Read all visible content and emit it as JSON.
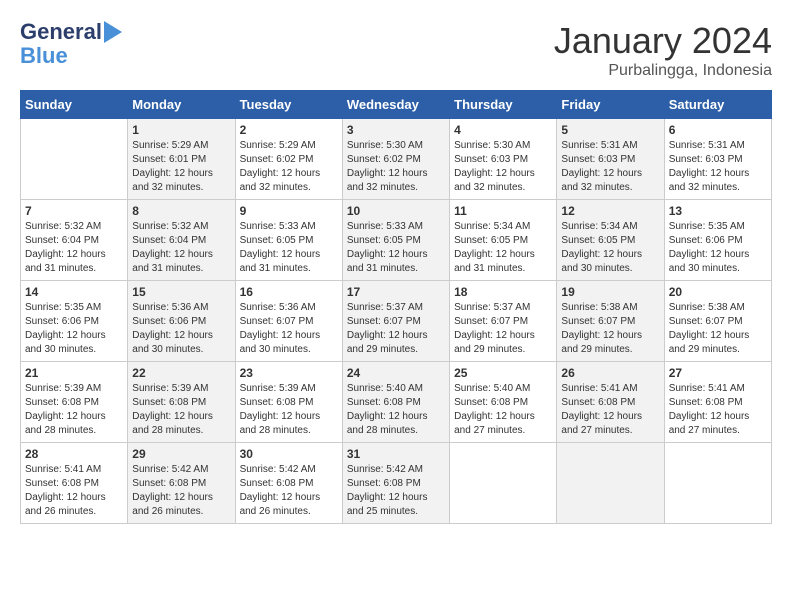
{
  "header": {
    "logo_line1": "General",
    "logo_line2": "Blue",
    "month": "January 2024",
    "location": "Purbalingga, Indonesia"
  },
  "weekdays": [
    "Sunday",
    "Monday",
    "Tuesday",
    "Wednesday",
    "Thursday",
    "Friday",
    "Saturday"
  ],
  "weeks": [
    [
      {
        "day": "",
        "info": ""
      },
      {
        "day": "1",
        "info": "Sunrise: 5:29 AM\nSunset: 6:01 PM\nDaylight: 12 hours\nand 32 minutes."
      },
      {
        "day": "2",
        "info": "Sunrise: 5:29 AM\nSunset: 6:02 PM\nDaylight: 12 hours\nand 32 minutes."
      },
      {
        "day": "3",
        "info": "Sunrise: 5:30 AM\nSunset: 6:02 PM\nDaylight: 12 hours\nand 32 minutes."
      },
      {
        "day": "4",
        "info": "Sunrise: 5:30 AM\nSunset: 6:03 PM\nDaylight: 12 hours\nand 32 minutes."
      },
      {
        "day": "5",
        "info": "Sunrise: 5:31 AM\nSunset: 6:03 PM\nDaylight: 12 hours\nand 32 minutes."
      },
      {
        "day": "6",
        "info": "Sunrise: 5:31 AM\nSunset: 6:03 PM\nDaylight: 12 hours\nand 32 minutes."
      }
    ],
    [
      {
        "day": "7",
        "info": "Sunrise: 5:32 AM\nSunset: 6:04 PM\nDaylight: 12 hours\nand 31 minutes."
      },
      {
        "day": "8",
        "info": "Sunrise: 5:32 AM\nSunset: 6:04 PM\nDaylight: 12 hours\nand 31 minutes."
      },
      {
        "day": "9",
        "info": "Sunrise: 5:33 AM\nSunset: 6:05 PM\nDaylight: 12 hours\nand 31 minutes."
      },
      {
        "day": "10",
        "info": "Sunrise: 5:33 AM\nSunset: 6:05 PM\nDaylight: 12 hours\nand 31 minutes."
      },
      {
        "day": "11",
        "info": "Sunrise: 5:34 AM\nSunset: 6:05 PM\nDaylight: 12 hours\nand 31 minutes."
      },
      {
        "day": "12",
        "info": "Sunrise: 5:34 AM\nSunset: 6:05 PM\nDaylight: 12 hours\nand 30 minutes."
      },
      {
        "day": "13",
        "info": "Sunrise: 5:35 AM\nSunset: 6:06 PM\nDaylight: 12 hours\nand 30 minutes."
      }
    ],
    [
      {
        "day": "14",
        "info": "Sunrise: 5:35 AM\nSunset: 6:06 PM\nDaylight: 12 hours\nand 30 minutes."
      },
      {
        "day": "15",
        "info": "Sunrise: 5:36 AM\nSunset: 6:06 PM\nDaylight: 12 hours\nand 30 minutes."
      },
      {
        "day": "16",
        "info": "Sunrise: 5:36 AM\nSunset: 6:07 PM\nDaylight: 12 hours\nand 30 minutes."
      },
      {
        "day": "17",
        "info": "Sunrise: 5:37 AM\nSunset: 6:07 PM\nDaylight: 12 hours\nand 29 minutes."
      },
      {
        "day": "18",
        "info": "Sunrise: 5:37 AM\nSunset: 6:07 PM\nDaylight: 12 hours\nand 29 minutes."
      },
      {
        "day": "19",
        "info": "Sunrise: 5:38 AM\nSunset: 6:07 PM\nDaylight: 12 hours\nand 29 minutes."
      },
      {
        "day": "20",
        "info": "Sunrise: 5:38 AM\nSunset: 6:07 PM\nDaylight: 12 hours\nand 29 minutes."
      }
    ],
    [
      {
        "day": "21",
        "info": "Sunrise: 5:39 AM\nSunset: 6:08 PM\nDaylight: 12 hours\nand 28 minutes."
      },
      {
        "day": "22",
        "info": "Sunrise: 5:39 AM\nSunset: 6:08 PM\nDaylight: 12 hours\nand 28 minutes."
      },
      {
        "day": "23",
        "info": "Sunrise: 5:39 AM\nSunset: 6:08 PM\nDaylight: 12 hours\nand 28 minutes."
      },
      {
        "day": "24",
        "info": "Sunrise: 5:40 AM\nSunset: 6:08 PM\nDaylight: 12 hours\nand 28 minutes."
      },
      {
        "day": "25",
        "info": "Sunrise: 5:40 AM\nSunset: 6:08 PM\nDaylight: 12 hours\nand 27 minutes."
      },
      {
        "day": "26",
        "info": "Sunrise: 5:41 AM\nSunset: 6:08 PM\nDaylight: 12 hours\nand 27 minutes."
      },
      {
        "day": "27",
        "info": "Sunrise: 5:41 AM\nSunset: 6:08 PM\nDaylight: 12 hours\nand 27 minutes."
      }
    ],
    [
      {
        "day": "28",
        "info": "Sunrise: 5:41 AM\nSunset: 6:08 PM\nDaylight: 12 hours\nand 26 minutes."
      },
      {
        "day": "29",
        "info": "Sunrise: 5:42 AM\nSunset: 6:08 PM\nDaylight: 12 hours\nand 26 minutes."
      },
      {
        "day": "30",
        "info": "Sunrise: 5:42 AM\nSunset: 6:08 PM\nDaylight: 12 hours\nand 26 minutes."
      },
      {
        "day": "31",
        "info": "Sunrise: 5:42 AM\nSunset: 6:08 PM\nDaylight: 12 hours\nand 25 minutes."
      },
      {
        "day": "",
        "info": ""
      },
      {
        "day": "",
        "info": ""
      },
      {
        "day": "",
        "info": ""
      }
    ]
  ]
}
